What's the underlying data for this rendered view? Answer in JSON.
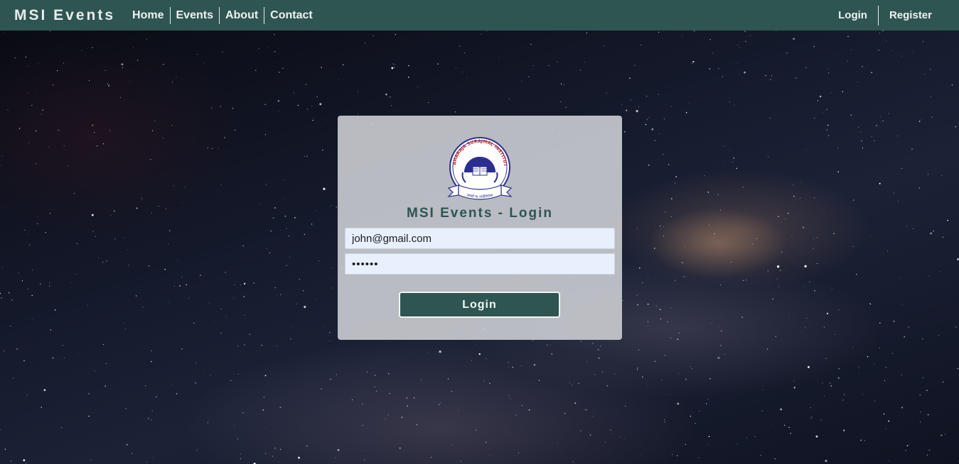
{
  "navbar": {
    "brand": "MSI Events",
    "links": [
      "Home",
      "Events",
      "About",
      "Contact"
    ],
    "auth": {
      "login": "Login",
      "register": "Register"
    },
    "color": "#2f5552"
  },
  "login_card": {
    "title": "MSI Events - Login",
    "logo_text": "MAHARAJA SURAJMAL INSTITUTE",
    "logo_motto": "तमसो मा ज्योतिर्गमय",
    "email_value": "john@gmail.com",
    "password_value": "••••••",
    "button_label": "Login"
  },
  "background": {
    "description_icon": "starfield-background"
  }
}
